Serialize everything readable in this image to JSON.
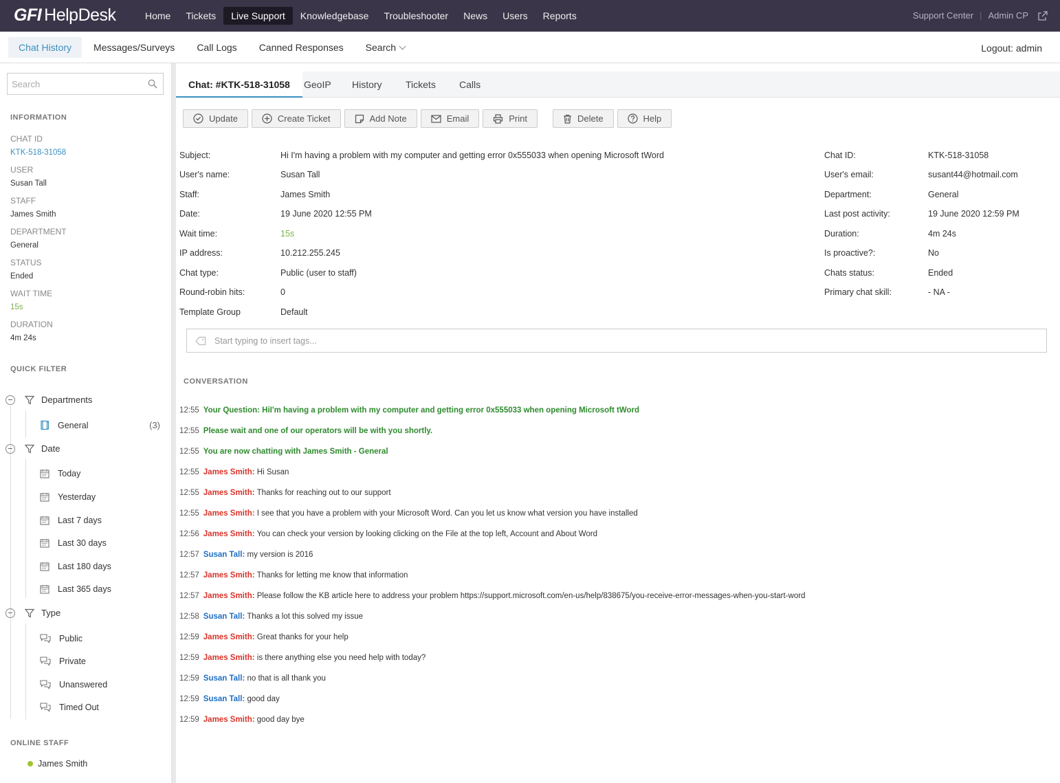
{
  "app": {
    "logo_gfi": "GFI",
    "logo_name": "HelpDesk"
  },
  "topnav": [
    "Home",
    "Tickets",
    "Live Support",
    "Knowledgebase",
    "Troubleshooter",
    "News",
    "Users",
    "Reports"
  ],
  "topright": {
    "support_center": "Support Center",
    "separator": "|",
    "admin_cp": "Admin CP"
  },
  "subnav": [
    "Chat History",
    "Messages/Surveys",
    "Call Logs",
    "Canned Responses",
    "Search"
  ],
  "logout": "Logout: admin",
  "sidebar": {
    "search_placeholder": "Search",
    "information_title": "INFORMATION",
    "info": [
      {
        "label": "CHAT ID",
        "value": "KTK-518-31058"
      },
      {
        "label": "USER",
        "value": "Susan Tall"
      },
      {
        "label": "STAFF",
        "value": "James Smith"
      },
      {
        "label": "DEPARTMENT",
        "value": "General"
      },
      {
        "label": "STATUS",
        "value": "Ended"
      },
      {
        "label": "WAIT TIME",
        "value": "15s"
      },
      {
        "label": "DURATION",
        "value": "4m 24s"
      }
    ],
    "quick_filter_title": "QUICK FILTER",
    "departments_label": "Departments",
    "departments": [
      {
        "label": "General",
        "count": "(3)"
      }
    ],
    "date_label": "Date",
    "dates": [
      "Today",
      "Yesterday",
      "Last 7 days",
      "Last 30 days",
      "Last 180 days",
      "Last 365 days"
    ],
    "type_label": "Type",
    "types": [
      "Public",
      "Private",
      "Unanswered",
      "Timed Out"
    ],
    "online_staff_title": "ONLINE STAFF",
    "online_staff": [
      "James Smith"
    ]
  },
  "tabs": [
    "Chat: #KTK-518-31058",
    "GeoIP",
    "History",
    "Tickets",
    "Calls"
  ],
  "toolbar": [
    "Update",
    "Create Ticket",
    "Add Note",
    "Email",
    "Print",
    "Delete",
    "Help"
  ],
  "details_left": [
    {
      "label": "Subject:",
      "value": "Hi I'm having a problem with my computer and getting error 0x555033 when opening Microsoft tWord"
    },
    {
      "label": "User's name:",
      "value": "Susan Tall"
    },
    {
      "label": "Staff:",
      "value": "James Smith"
    },
    {
      "label": "Date:",
      "value": "19 June 2020 12:55 PM"
    },
    {
      "label": "Wait time:",
      "value": "15s"
    },
    {
      "label": "IP address:",
      "value": "10.212.255.245"
    },
    {
      "label": "Chat type:",
      "value": "Public (user to staff)"
    },
    {
      "label": "Round-robin hits:",
      "value": "0"
    },
    {
      "label": "Template Group",
      "value": "Default"
    }
  ],
  "details_right": [
    {
      "label": "Chat ID:",
      "value": "KTK-518-31058"
    },
    {
      "label": "User's email:",
      "value": "susant44@hotmail.com"
    },
    {
      "label": "Department:",
      "value": "General"
    },
    {
      "label": "Last post activity:",
      "value": "19 June 2020 12:59 PM"
    },
    {
      "label": "Duration:",
      "value": "4m 24s"
    },
    {
      "label": "Is proactive?:",
      "value": "No"
    },
    {
      "label": "Chats status:",
      "value": "Ended"
    },
    {
      "label": "Primary chat skill:",
      "value": "- NA -"
    }
  ],
  "tags_placeholder": "Start typing to insert tags...",
  "conversation_title": "CONVERSATION",
  "conversation": [
    {
      "time": "12:55",
      "kind": "sys",
      "speaker": "",
      "text": "Your Question: HiI'm having a problem with my computer and getting error 0x555033 when opening Microsoft tWord"
    },
    {
      "time": "12:55",
      "kind": "sys",
      "speaker": "",
      "text": "Please wait and one of our operators will be with you shortly."
    },
    {
      "time": "12:55",
      "kind": "sys",
      "speaker": "",
      "text": "You are now chatting with James Smith - General"
    },
    {
      "time": "12:55",
      "kind": "staff",
      "speaker": "James Smith:",
      "text": "Hi Susan"
    },
    {
      "time": "12:55",
      "kind": "staff",
      "speaker": "James Smith:",
      "text": "Thanks for reaching out to our support"
    },
    {
      "time": "12:55",
      "kind": "staff",
      "speaker": "James Smith:",
      "text": "I see that you have a problem with your Microsoft Word. Can you let us know what version you have installed"
    },
    {
      "time": "12:56",
      "kind": "staff",
      "speaker": "James Smith:",
      "text": "You can check your version by looking clicking on the File at the top left, Account and About Word"
    },
    {
      "time": "12:57",
      "kind": "user",
      "speaker": "Susan Tall:",
      "text": "my version is 2016"
    },
    {
      "time": "12:57",
      "kind": "staff",
      "speaker": "James Smith:",
      "text": "Thanks for letting me know that information"
    },
    {
      "time": "12:57",
      "kind": "staff",
      "speaker": "James Smith:",
      "text": "Please follow the KB article here to address your problem https://support.microsoft.com/en-us/help/838675/you-receive-error-messages-when-you-start-word"
    },
    {
      "time": "12:58",
      "kind": "user",
      "speaker": "Susan Tall:",
      "text": "Thanks a lot this solved my issue"
    },
    {
      "time": "12:59",
      "kind": "staff",
      "speaker": "James Smith:",
      "text": "Great thanks for your help"
    },
    {
      "time": "12:59",
      "kind": "staff",
      "speaker": "James Smith:",
      "text": "is there anything else you need help with today?"
    },
    {
      "time": "12:59",
      "kind": "user",
      "speaker": "Susan Tall:",
      "text": "no that is all thank you"
    },
    {
      "time": "12:59",
      "kind": "user",
      "speaker": "Susan Tall:",
      "text": "good day"
    },
    {
      "time": "12:59",
      "kind": "staff",
      "speaker": "James Smith:",
      "text": "good day bye"
    }
  ]
}
